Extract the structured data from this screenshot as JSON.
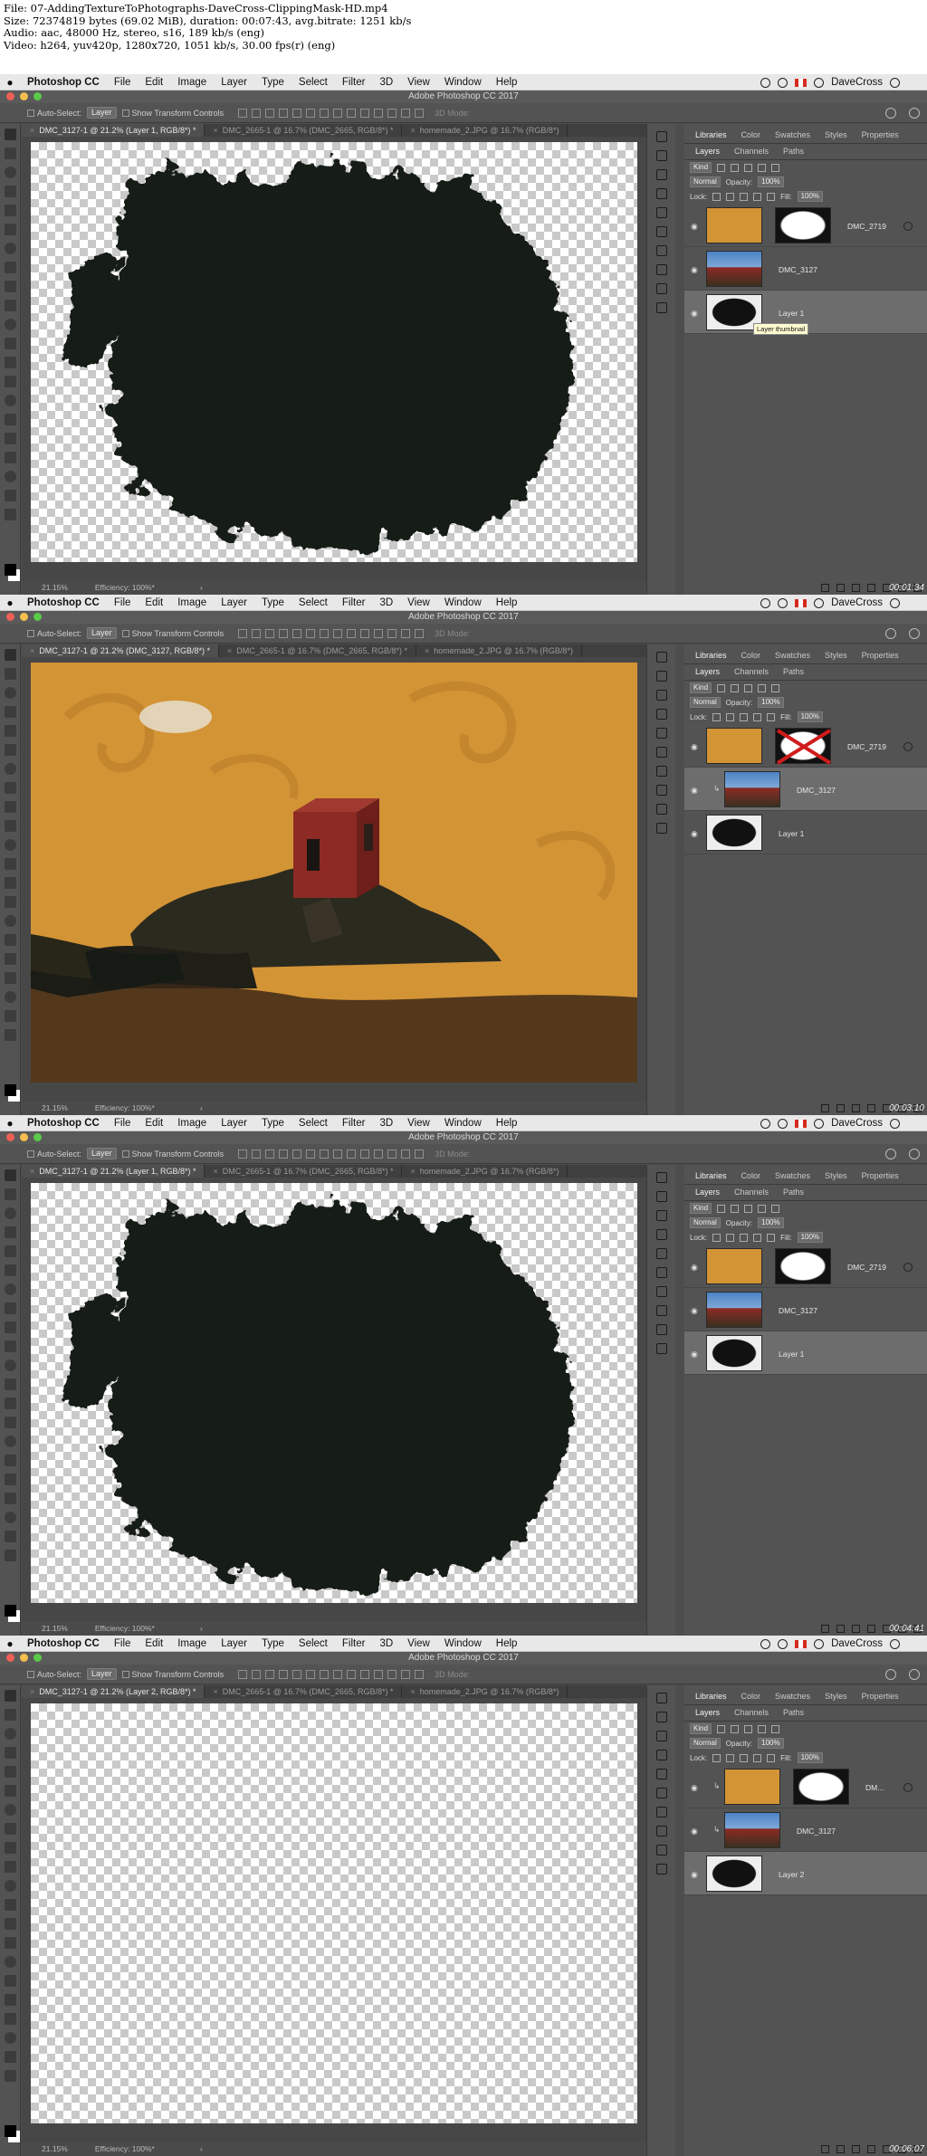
{
  "header": {
    "lines": [
      "File: 07-AddingTextureToPhotographs-DaveCross-ClippingMask-HD.mp4",
      "Size: 72374819 bytes (69.02 MiB), duration: 00:07:43, avg.bitrate: 1251 kb/s",
      "Audio: aac, 48000 Hz, stereo, s16, 189 kb/s (eng)",
      "Video: h264, yuv420p, 1280x720, 1051 kb/s, 30.00 fps(r) (eng)"
    ]
  },
  "app": {
    "menus": [
      "Photoshop CC",
      "File",
      "Edit",
      "Image",
      "Layer",
      "Type",
      "Select",
      "Filter",
      "3D",
      "View",
      "Window",
      "Help"
    ],
    "user": "DaveCross",
    "window_title": "Adobe Photoshop CC 2017",
    "options": {
      "auto_select": "Auto-Select:",
      "auto_select_value": "Layer",
      "show_transform": "Show Transform Controls",
      "mode_3d": "3D Mode:"
    },
    "panel_tabs": [
      "Libraries",
      "Color",
      "Swatches",
      "Styles",
      "Properties"
    ],
    "layer_tabs": [
      "Layers",
      "Channels",
      "Paths"
    ],
    "kind": "Kind",
    "blend": "Normal",
    "opacity_label": "Opacity:",
    "opacity": "100%",
    "lock_label": "Lock:",
    "fill_label": "Fill:",
    "fill": "100%"
  },
  "frames": [
    {
      "tabs": [
        "DMC_3127-1 @ 21.2% (Layer 1, RGB/8*) *",
        "DMC_2665-1 @ 16.7% (DMC_2665, RGB/8*) *",
        "homemade_2.JPG @ 16.7% (RGB/8*)"
      ],
      "zoom": "21.15%",
      "efficiency": "Efficiency: 100%*",
      "layers": [
        "DMC_2719",
        "DMC_3127",
        "Layer 1"
      ],
      "selected": 2,
      "tooltip": "Layer thumbnail",
      "timecode": "00:01:34"
    },
    {
      "tabs": [
        "DMC_3127-1 @ 21.2% (DMC_3127, RGB/8*) *",
        "DMC_2665-1 @ 16.7% (DMC_2665, RGB/8*) *",
        "homemade_2.JPG @ 16.7% (RGB/8*)"
      ],
      "zoom": "21.15%",
      "efficiency": "Efficiency: 100%*",
      "layers": [
        "DMC_2719",
        "DMC_3127",
        "Layer 1"
      ],
      "selected": 1,
      "tooltip": "",
      "timecode": "00:03:10"
    },
    {
      "tabs": [
        "DMC_3127-1 @ 21.2% (Layer 1, RGB/8*) *",
        "DMC_2665-1 @ 16.7% (DMC_2665, RGB/8*) *",
        "homemade_2.JPG @ 16.7% (RGB/8*)"
      ],
      "zoom": "21.15%",
      "efficiency": "Efficiency: 100%*",
      "layers": [
        "DMC_2719",
        "DMC_3127",
        "Layer 1"
      ],
      "selected": 2,
      "tooltip": "",
      "timecode": "00:04:41"
    },
    {
      "tabs": [
        "DMC_3127-1 @ 21.2% (Layer 2, RGB/8*) *",
        "DMC_2665-1 @ 16.7% (DMC_2665, RGB/8*) *",
        "homemade_2.JPG @ 16.7% (RGB/8*)"
      ],
      "zoom": "21.15%",
      "efficiency": "Efficiency: 100%*",
      "layers": [
        "DM...",
        "DMC_3127",
        "Layer 2"
      ],
      "selected": 2,
      "tooltip": "",
      "timecode": "00:06:07"
    }
  ],
  "colors": {
    "texture": "#d39436",
    "ink": "#141a15",
    "building": "#8d2a24",
    "sky": "#3f8fd1"
  }
}
